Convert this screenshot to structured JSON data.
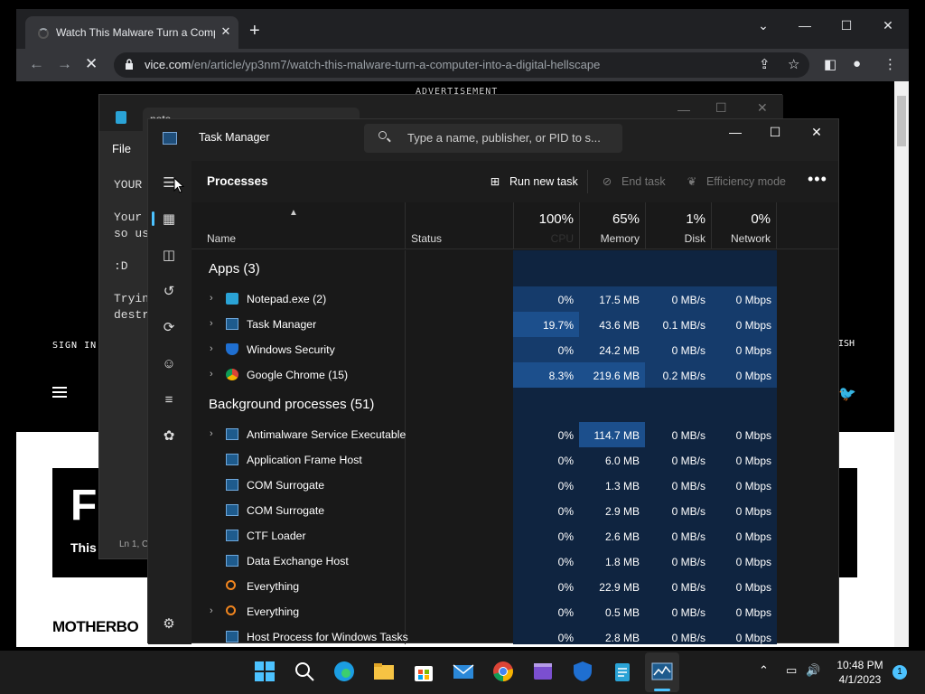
{
  "browser": {
    "tab_title": "Watch This Malware Turn a Computer into a Digital Hellscape",
    "tab_close": "✕",
    "new_tab": "+",
    "url_domain": "vice.com",
    "url_path": "/en/article/yp3nm7/watch-this-malware-turn-a-computer-into-a-digital-hellscape",
    "page": {
      "ad_label": "ADVERTISEMENT",
      "sign_in": "SIGN IN",
      "right_label": "ISH",
      "hero_big": "F",
      "hero_small": "This",
      "brand": "MOTHERBO"
    }
  },
  "notepad": {
    "tab_label": "note",
    "menu_file": "File",
    "lines": [
      "YOUR",
      "Your",
      "so us",
      ":D",
      "Tryin",
      "destr"
    ],
    "status": "Ln 1, C"
  },
  "taskmanager": {
    "title": "Task Manager",
    "search_placeholder": "Type a name, publisher, or PID to s...",
    "page_title": "Processes",
    "run_new_task": "Run new task",
    "end_task": "End task",
    "efficiency_mode": "Efficiency mode",
    "more": "•••",
    "columns": {
      "name": "Name",
      "status": "Status",
      "cpu_pct": "100%",
      "cpu": "CPU",
      "memory_pct": "65%",
      "memory": "Memory",
      "disk_pct": "1%",
      "disk": "Disk",
      "network_pct": "0%",
      "network": "Network"
    },
    "groups": {
      "apps": "Apps (3)",
      "background": "Background processes (51)"
    },
    "apps": [
      {
        "name": "Notepad.exe (2)",
        "cpu": "0%",
        "memory": "17.5 MB",
        "disk": "0 MB/s",
        "network": "0 Mbps",
        "icon": "notepad-icon"
      },
      {
        "name": "Task Manager",
        "cpu": "19.7%",
        "memory": "43.6 MB",
        "disk": "0.1 MB/s",
        "network": "0 Mbps",
        "icon": "taskmanager-icon"
      },
      {
        "name": "Windows Security",
        "cpu": "0%",
        "memory": "24.2 MB",
        "disk": "0 MB/s",
        "network": "0 Mbps",
        "icon": "shield-icon"
      },
      {
        "name": "Google Chrome (15)",
        "cpu": "8.3%",
        "memory": "219.6 MB",
        "disk": "0.2 MB/s",
        "network": "0 Mbps",
        "icon": "chrome-icon"
      }
    ],
    "background": [
      {
        "name": "Antimalware Service Executable",
        "cpu": "0%",
        "memory": "114.7 MB",
        "disk": "0 MB/s",
        "network": "0 Mbps"
      },
      {
        "name": "Application Frame Host",
        "cpu": "0%",
        "memory": "6.0 MB",
        "disk": "0 MB/s",
        "network": "0 Mbps"
      },
      {
        "name": "COM Surrogate",
        "cpu": "0%",
        "memory": "1.3 MB",
        "disk": "0 MB/s",
        "network": "0 Mbps"
      },
      {
        "name": "COM Surrogate",
        "cpu": "0%",
        "memory": "2.9 MB",
        "disk": "0 MB/s",
        "network": "0 Mbps"
      },
      {
        "name": "CTF Loader",
        "cpu": "0%",
        "memory": "2.6 MB",
        "disk": "0 MB/s",
        "network": "0 Mbps"
      },
      {
        "name": "Data Exchange Host",
        "cpu": "0%",
        "memory": "1.8 MB",
        "disk": "0 MB/s",
        "network": "0 Mbps"
      },
      {
        "name": "Everything",
        "cpu": "0%",
        "memory": "22.9 MB",
        "disk": "0 MB/s",
        "network": "0 Mbps"
      },
      {
        "name": "Everything",
        "cpu": "0%",
        "memory": "0.5 MB",
        "disk": "0 MB/s",
        "network": "0 Mbps"
      },
      {
        "name": "Host Process for Windows Tasks",
        "cpu": "0%",
        "memory": "2.8 MB",
        "disk": "0 MB/s",
        "network": "0 Mbps"
      }
    ]
  },
  "taskbar": {
    "time": "10:48 PM",
    "date": "4/1/2023",
    "notifications": "1"
  },
  "colors": {
    "accent": "#4cc2ff",
    "heat_low": "#0f2a4a",
    "heat_mid": "#153b6b",
    "heat_high": "#1c4f8c"
  }
}
